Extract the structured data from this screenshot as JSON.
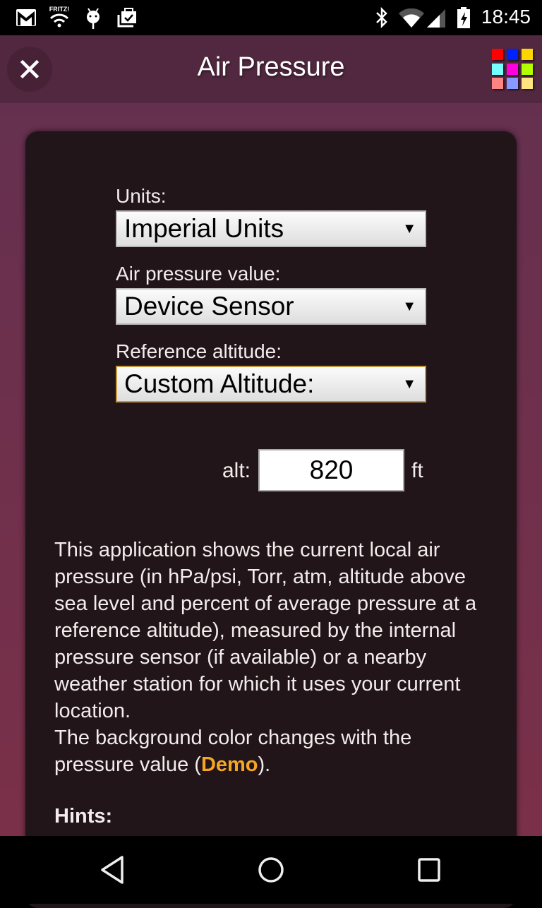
{
  "status_bar": {
    "left_icons": [
      "gmail-icon",
      "fritz-wifi-icon",
      "android-debug-icon",
      "briefcase-check-icon"
    ],
    "fritz_label": "FRITZ!",
    "right_icons": [
      "bluetooth-icon",
      "wifi-icon",
      "cell-signal-icon",
      "battery-charging-icon"
    ],
    "time": "18:45"
  },
  "app_bar": {
    "title": "Air Pressure",
    "close_icon": "close-icon",
    "palette_colors": [
      "#ff0000",
      "#0022ff",
      "#ffd500",
      "#77ffff",
      "#ff00dd",
      "#b3ff00",
      "#ff8585",
      "#8899ff",
      "#ffe57f"
    ]
  },
  "form": {
    "units": {
      "label": "Units:",
      "value": "Imperial Units"
    },
    "pressure_source": {
      "label": "Air pressure value:",
      "value": "Device Sensor"
    },
    "reference_altitude": {
      "label": "Reference altitude:",
      "value": "Custom Altitude:"
    },
    "altitude": {
      "label": "alt:",
      "value": "820",
      "unit": "ft"
    }
  },
  "description": {
    "text": "This application shows the current local air pressure (in hPa/psi, Torr, atm, altitude above sea level and percent of average pressure at a reference altitude), measured by the internal pressure sensor (if available) or a nearby weather station for which it uses your current location.",
    "text2_prefix": "The background color changes with the pressure value (",
    "demo_link": "Demo",
    "text2_suffix": ")."
  },
  "hints": {
    "heading": "Hints:"
  },
  "colors": {
    "accent_link": "#f5a623",
    "focus_border": "#c8963a",
    "card_bg": "#211519"
  },
  "nav_bar": {
    "buttons": [
      "back",
      "home",
      "recents"
    ]
  }
}
